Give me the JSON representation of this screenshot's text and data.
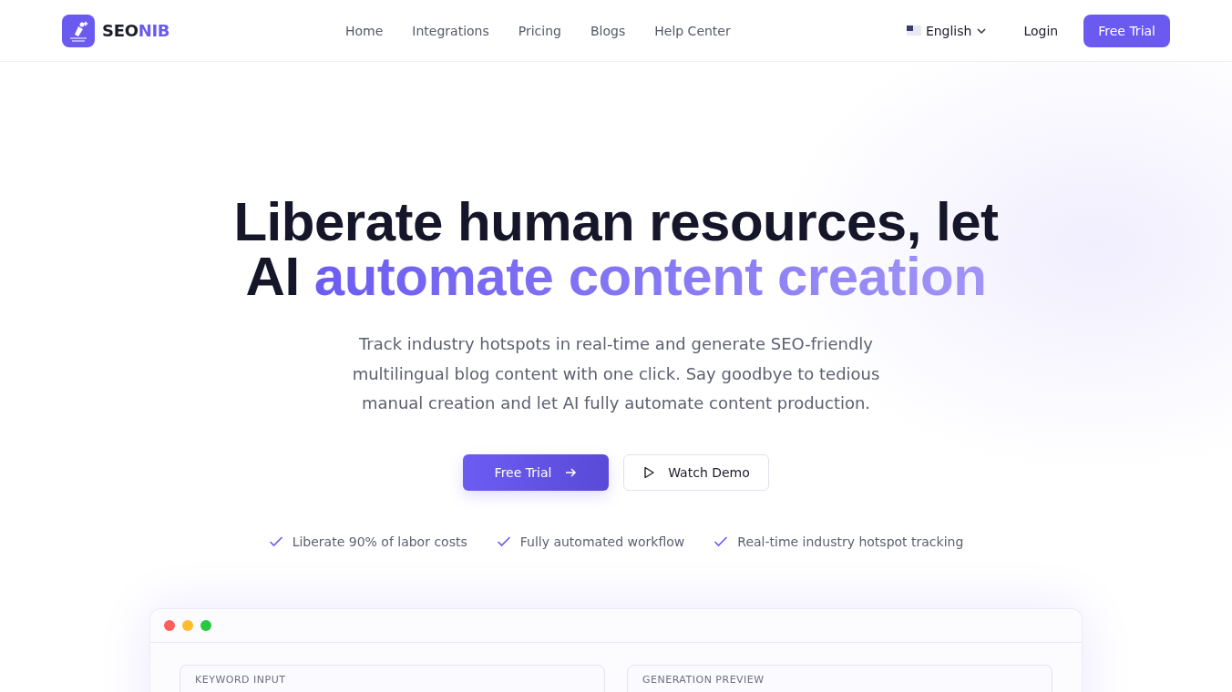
{
  "brand": {
    "prefix": "SEO",
    "suffix": "NIB"
  },
  "nav": {
    "links": [
      {
        "label": "Home"
      },
      {
        "label": "Integrations"
      },
      {
        "label": "Pricing"
      },
      {
        "label": "Blogs"
      },
      {
        "label": "Help Center"
      }
    ],
    "language": "English",
    "login": "Login",
    "cta": "Free Trial"
  },
  "hero": {
    "heading_lead": "Liberate human resources, let AI",
    "heading_highlight": "automate content creation",
    "subtitle": "Track industry hotspots in real-time and generate SEO-friendly multilingual blog content with one click. Say goodbye to tedious manual creation and let AI fully automate content production.",
    "primary_button": "Free Trial",
    "secondary_button": "Watch Demo",
    "features": [
      "Liberate 90% of labor costs",
      "Fully automated workflow",
      "Real-time industry hotspot tracking"
    ]
  },
  "preview": {
    "window_dots": [
      {
        "color": "#ff5f57"
      },
      {
        "color": "#febc2e"
      },
      {
        "color": "#28c840"
      }
    ],
    "panels": [
      {
        "title": "KEYWORD INPUT"
      },
      {
        "title": "GENERATION PREVIEW"
      }
    ]
  }
}
